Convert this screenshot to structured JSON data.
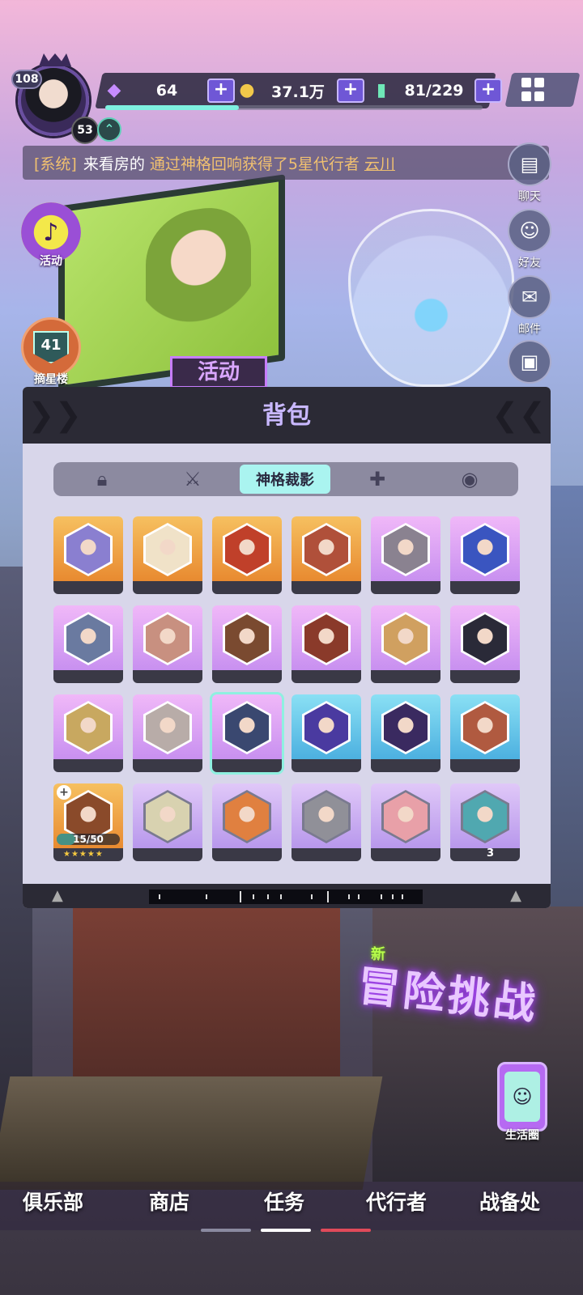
{
  "player": {
    "level": "108",
    "rank": "53"
  },
  "resources": {
    "gems": "64",
    "coins": "37.1万",
    "stamina": "81/229",
    "stamina_fraction": 0.354
  },
  "system_message": {
    "tag": "[系统]",
    "user": "来看房的",
    "text": "通过神格回响获得了5星代行者",
    "target": "云川"
  },
  "side_menu": [
    {
      "label": "聊天",
      "icon": "chat-icon"
    },
    {
      "label": "好友",
      "icon": "friends-icon"
    },
    {
      "label": "邮件",
      "icon": "mail-icon"
    },
    {
      "label": "",
      "icon": "bag-icon"
    }
  ],
  "activity": {
    "label": "活动"
  },
  "floor": {
    "label": "摘星楼",
    "value": "41"
  },
  "billboard_sign": "活动",
  "backpack": {
    "title": "背包",
    "tabs": [
      {
        "label": "",
        "icon": "lock-bag-icon"
      },
      {
        "label": "",
        "icon": "sword-icon"
      },
      {
        "label": "神格裁影",
        "icon": ""
      },
      {
        "label": "",
        "icon": "puzzle-icon"
      },
      {
        "label": "",
        "icon": "mask-icon"
      }
    ],
    "items": [
      {
        "rarity": "gold",
        "portrait": "#8a7fd0"
      },
      {
        "rarity": "gold",
        "portrait": "#f0e2c8"
      },
      {
        "rarity": "gold",
        "portrait": "#c0402a"
      },
      {
        "rarity": "gold",
        "portrait": "#b0503a"
      },
      {
        "rarity": "purple",
        "portrait": "#8a8290"
      },
      {
        "rarity": "purple",
        "portrait": "#3a55c0"
      },
      {
        "rarity": "purple",
        "portrait": "#6a7aa0"
      },
      {
        "rarity": "purple",
        "portrait": "#c89080"
      },
      {
        "rarity": "purple",
        "portrait": "#7a4a30"
      },
      {
        "rarity": "purple",
        "portrait": "#8a3a2a"
      },
      {
        "rarity": "purple",
        "portrait": "#d0a060"
      },
      {
        "rarity": "purple",
        "portrait": "#2a2a38"
      },
      {
        "rarity": "purple",
        "portrait": "#c8a860"
      },
      {
        "rarity": "purple",
        "portrait": "#b8aca8"
      },
      {
        "rarity": "purple",
        "portrait": "#3a4870",
        "selected": true
      },
      {
        "rarity": "blue",
        "portrait": "#4a3aa0"
      },
      {
        "rarity": "blue",
        "portrait": "#3a2a60"
      },
      {
        "rarity": "blue",
        "portrait": "#b05a40"
      },
      {
        "rarity": "gold",
        "portrait": "#8a4a2a",
        "progress": "15/50",
        "progress_fraction": 0.3,
        "stars": "★★★★★",
        "has_plus": true
      },
      {
        "rarity": "silver",
        "portrait": "#d8d2b0"
      },
      {
        "rarity": "silver",
        "portrait": "#e08040"
      },
      {
        "rarity": "silver",
        "portrait": "#909098"
      },
      {
        "rarity": "silver",
        "portrait": "#e8a0a8"
      },
      {
        "rarity": "silver",
        "portrait": "#50a8b0",
        "count": "3"
      }
    ]
  },
  "new_tag": "新",
  "adventure_label": "冒险挑战",
  "life_circle": {
    "label": "生活圈"
  },
  "bottom_nav": [
    {
      "label": "俱乐部"
    },
    {
      "label": "商店"
    },
    {
      "label": "任务"
    },
    {
      "label": "代行者"
    },
    {
      "label": "战备处"
    }
  ],
  "colors": {
    "accent_purple": "#6f57d6",
    "active_tab": "#aaf4f0",
    "gold_card": "#f0a640",
    "purple_card": "#d8a2f0",
    "blue_card": "#62c8e8",
    "silver_card": "#c8aef0"
  }
}
